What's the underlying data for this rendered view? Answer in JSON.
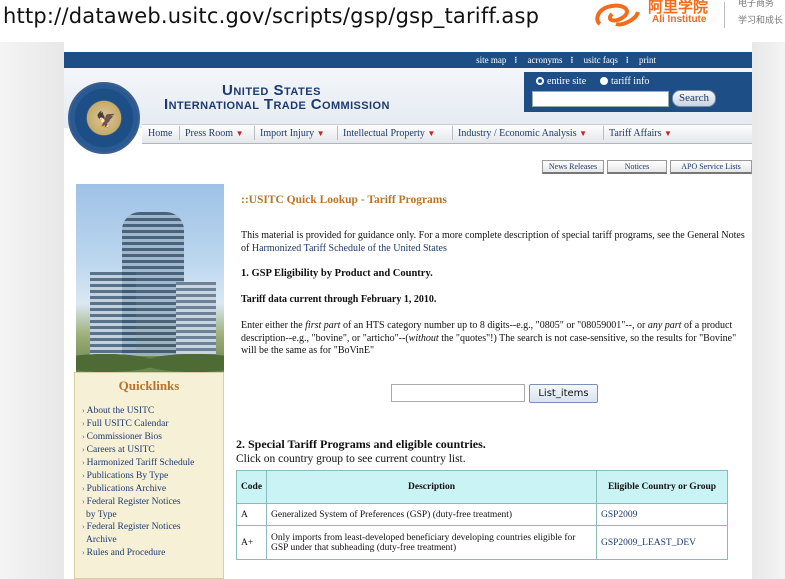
{
  "browser": {
    "url": "http://dataweb.usitc.gov/scripts/gsp/gsp_tariff.asp"
  },
  "watermark": {
    "brand_cn": "阿里学院",
    "brand_en": "Ali Institute",
    "tagline_line1": "电子商务",
    "tagline_line2": "学习和成长",
    "color": "#f26c1b"
  },
  "site": {
    "top_links": [
      "site map",
      "acronyms",
      "usitc faqs",
      "print"
    ],
    "title_line1": "United States",
    "title_line2": "International Trade Commission",
    "search": {
      "option_site": "entire site",
      "option_tariff": "tariff info",
      "selected": "entire site",
      "button": "Search",
      "value": ""
    },
    "nav": [
      {
        "label": "Home",
        "dropdown": false
      },
      {
        "label": "Press Room",
        "dropdown": true
      },
      {
        "label": "Import Injury",
        "dropdown": true
      },
      {
        "label": "Intellectual Property",
        "dropdown": true
      },
      {
        "label": "Industry / Economic Analysis",
        "dropdown": true
      },
      {
        "label": "Tariff Affairs",
        "dropdown": true
      }
    ],
    "sub_tabs": [
      "News Releases",
      "Notices",
      "APO Service Lists"
    ],
    "colors": {
      "brand_blue": "#1d4f86",
      "accent_orange": "#b8742a",
      "link": "#1d3a6e",
      "table_header": "#c9f3f5"
    }
  },
  "sidebar": {
    "quicklinks_title": "Quicklinks",
    "links": [
      "About the USITC",
      "Full USITC Calendar",
      "Commissioner Bios",
      "Careers at USITC",
      "Harmonized Tariff Schedule",
      "Publications By Type",
      "Publications Archive",
      "Federal Register Notices",
      "by Type",
      "Federal Register Notices",
      "Archive",
      "Rules and Procedure"
    ]
  },
  "main": {
    "heading": "::USITC Quick Lookup - Tariff Programs",
    "intro_before": "This material is provided for guidance only. For a more complete description of special tariff programs, see the General Notes of ",
    "intro_link": "Harmonized Tariff Schedule of the United States",
    "section1": "1. GSP Eligibility by Product and Country.",
    "data_current": "Tariff data current through February 1, 2010.",
    "instr_1": "Enter either the ",
    "instr_em1": "first part",
    "instr_2": " of an HTS category number up to 8 digits--e.g., \"0805\" or \"08059001\"--, or ",
    "instr_em2": "any part",
    "instr_3": " of a product description--e.g., \"bovine\", or \"articho\"--(",
    "instr_em3": "without",
    "instr_4": " the \"quotes\"!) The search is not case-sensitive, so the results for \"Bovine\" will be the same as for \"BoVinE\"",
    "lookup_value": "",
    "lookup_button": "List_items",
    "section2": "2. Special Tariff Programs and eligible countries.",
    "section2_sub": "Click on country group to see current country list.",
    "table": {
      "headers": [
        "Code",
        "Description",
        "Eligible Country or Group"
      ],
      "rows": [
        {
          "code": "A",
          "description": "Generalized System of Preferences (GSP) (duty-free treatment)",
          "group": "GSP2009"
        },
        {
          "code": "A+",
          "description": "Only imports from least-developed beneficiary developing countries eligible for GSP under that subheading (duty-free treatment)",
          "group": "GSP2009_LEAST_DEV"
        }
      ]
    }
  }
}
